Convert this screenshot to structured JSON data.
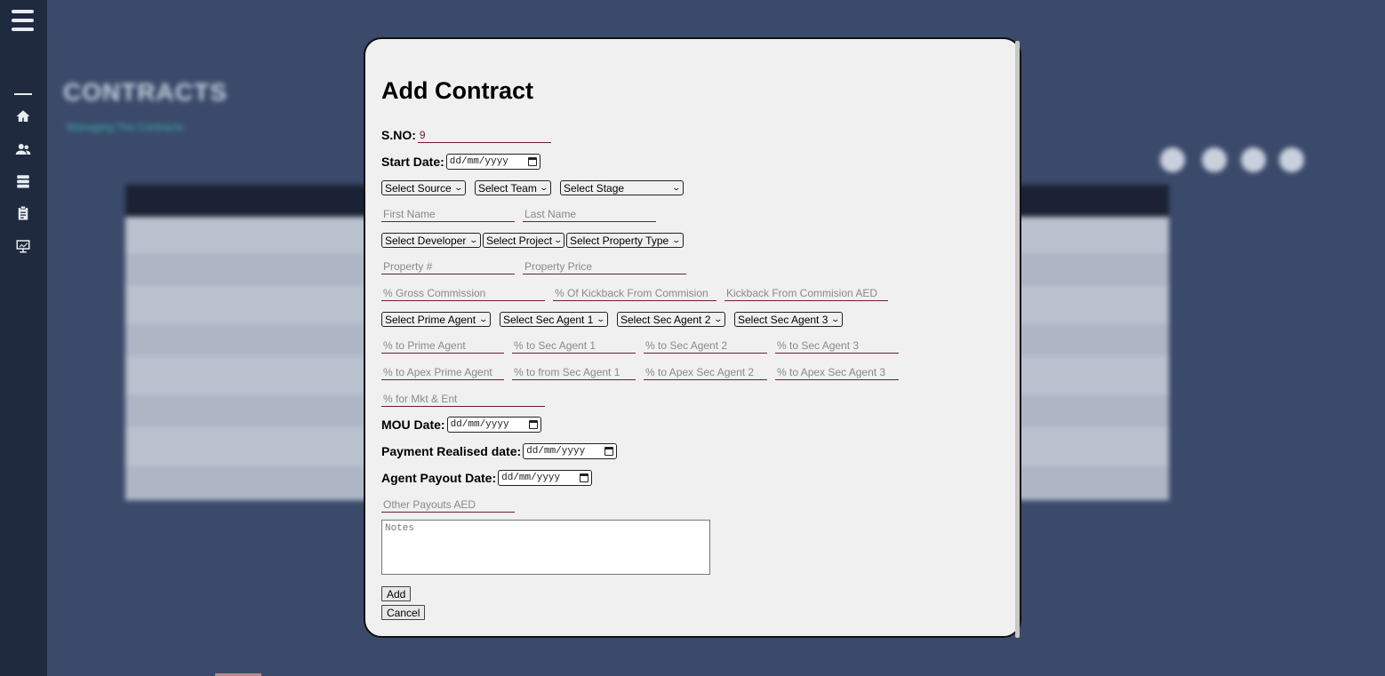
{
  "sidebar": {
    "icons": [
      "menu-icon",
      "home-icon",
      "users-icon",
      "database-icon",
      "clipboard-icon",
      "chart-icon"
    ]
  },
  "background": {
    "title": "CONTRACTS",
    "subtitle": "Managing The Contracts"
  },
  "modal": {
    "title": "Add Contract",
    "sno_label": "S.NO:",
    "sno_value": "9",
    "start_date_label": "Start Date:",
    "date_placeholder": "dd/mm/yyyy",
    "selects_row1": [
      "Select Source",
      "Select Team",
      "Select Stage"
    ],
    "first_name_placeholder": "First Name",
    "last_name_placeholder": "Last Name",
    "selects_row2": [
      "Select Developer",
      "Select Project",
      "Select Property Type"
    ],
    "property_no_placeholder": "Property #",
    "property_price_placeholder": "Property Price",
    "commission_placeholders": [
      "% Gross Commission",
      "% Of Kickback From Commision",
      "Kickback From Commision AED"
    ],
    "agent_selects": [
      "Select Prime Agent",
      "Select Sec Agent 1",
      "Select Sec Agent 2",
      "Select Sec Agent 3"
    ],
    "agent_pct_placeholders": [
      "% to Prime Agent",
      "% to Sec Agent 1",
      "% to Sec Agent 2",
      "% to Sec Agent 3"
    ],
    "apex_pct_placeholders": [
      "% to Apex Prime Agent",
      "% to from Sec Agent 1",
      "% to Apex Sec Agent 2",
      "% to Apex Sec Agent 3"
    ],
    "mkt_placeholder": "% for Mkt & Ent",
    "mou_label": "MOU Date:",
    "payment_label": "Payment Realised date:",
    "agent_payout_label": "Agent Payout Date:",
    "other_payouts_placeholder": "Other Payouts AED",
    "notes_placeholder": "Notes",
    "add_label": "Add",
    "cancel_label": "Cancel"
  }
}
